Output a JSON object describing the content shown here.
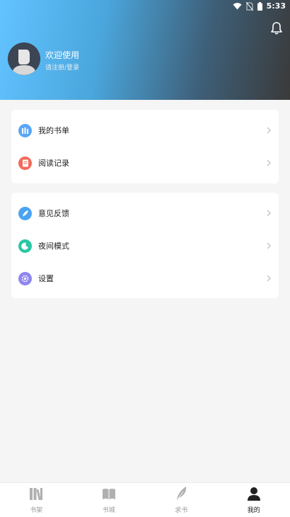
{
  "status_bar": {
    "time": "5:33"
  },
  "profile": {
    "welcome": "欢迎使用",
    "login_hint": "请注册/登录"
  },
  "menu_group_1": [
    {
      "label": "我的书单",
      "icon": "book-list-icon",
      "color": "#5aa6f5"
    },
    {
      "label": "阅读记录",
      "icon": "reading-history-icon",
      "color": "#f26b5b"
    }
  ],
  "menu_group_2": [
    {
      "label": "意见反馈",
      "icon": "feedback-feather-icon",
      "color": "#4aa3f3"
    },
    {
      "label": "夜间模式",
      "icon": "night-mode-icon",
      "color": "#2bc6a5"
    },
    {
      "label": "设置",
      "icon": "settings-gear-icon",
      "color": "#8f86f0"
    }
  ],
  "tabs": [
    {
      "label": "书架",
      "icon": "bookshelf-icon",
      "active": false
    },
    {
      "label": "书城",
      "icon": "bookstore-icon",
      "active": false
    },
    {
      "label": "求书",
      "icon": "request-book-icon",
      "active": false
    },
    {
      "label": "我的",
      "icon": "profile-person-icon",
      "active": true
    }
  ],
  "colors": {
    "accent_active_tab": "#222222",
    "inactive_tab": "#b0b0b0",
    "page_bg": "#f5f5f5"
  }
}
